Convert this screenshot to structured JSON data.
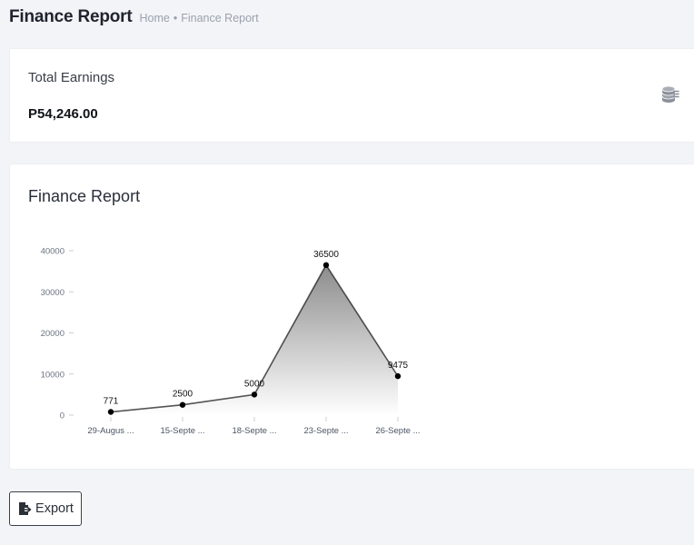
{
  "header": {
    "title": "Finance Report",
    "breadcrumb": [
      "Home",
      "Finance Report"
    ],
    "breadcrumb_separator": "•"
  },
  "earnings": {
    "label": "Total Earnings",
    "value": "P54,246.00",
    "icon": "coins-icon"
  },
  "report": {
    "title": "Finance Report"
  },
  "chart_data": {
    "type": "area",
    "categories": [
      "29-Augus ...",
      "15-Septe ...",
      "18-Septe ...",
      "23-Septe ...",
      "26-Septe ..."
    ],
    "values": [
      771,
      2500,
      5000,
      36500,
      9475
    ],
    "data_labels": [
      "771",
      "2500",
      "5000",
      "36500",
      "9475"
    ],
    "yticks": [
      0,
      10000,
      20000,
      30000,
      40000
    ],
    "ylim": [
      0,
      40000
    ],
    "line_color": "#1e1e1e",
    "fill_top_color": "#8c8c8c",
    "fill_bottom_color": "#ffffff",
    "grid": false
  },
  "actions": {
    "export_label": "Export",
    "export_icon": "file-export-icon"
  }
}
